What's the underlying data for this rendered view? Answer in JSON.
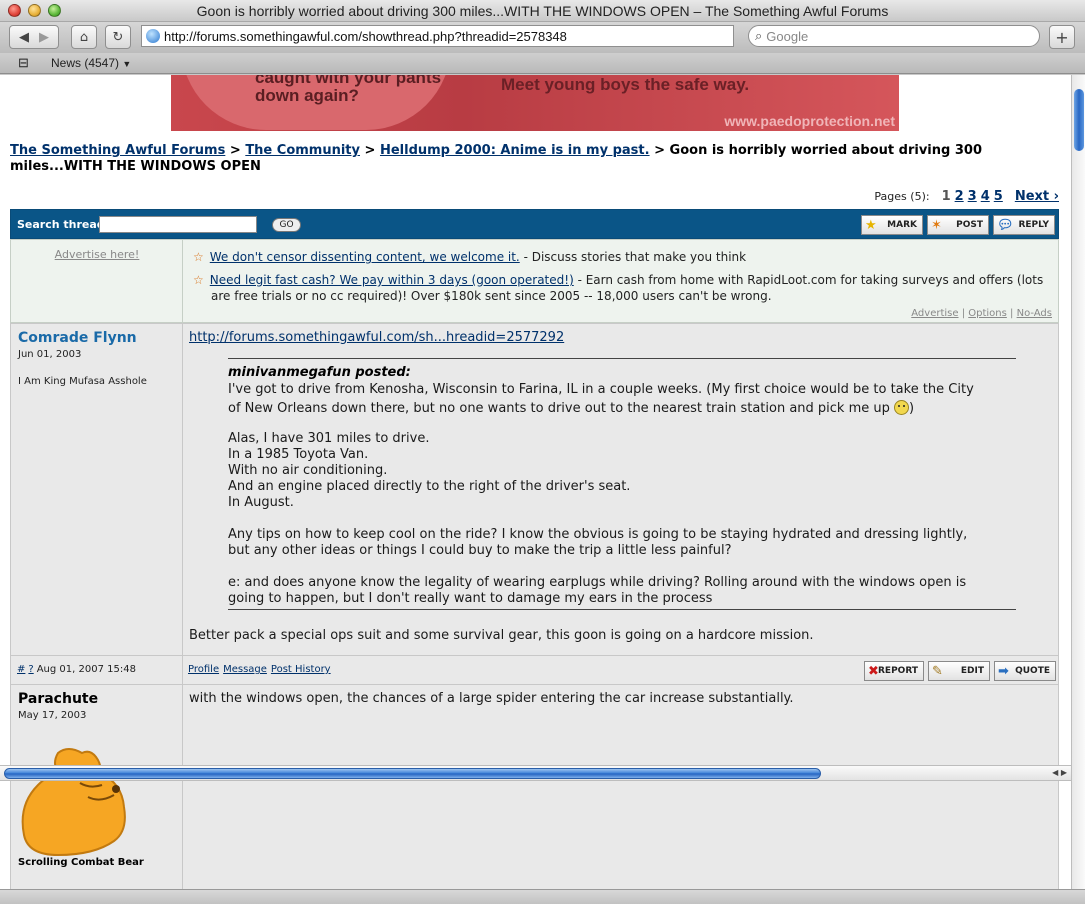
{
  "window": {
    "title": "Goon is horribly worried about driving 300 miles...WITH THE WINDOWS OPEN – The Something Awful Forums"
  },
  "toolbar": {
    "url": "http://forums.somethingawful.com/showthread.php?threadid=2578348",
    "search_placeholder": "Google",
    "add_tab": "+"
  },
  "bookmarks": {
    "news_label": "News (4547)"
  },
  "ad_banner": {
    "line1": "caught with your pants",
    "line2": "down again?",
    "tagline": "Meet young boys the safe way.",
    "url": "www.paedoprotection.net"
  },
  "breadcrumb": {
    "items": [
      "The Something Awful Forums",
      "The Community",
      "Helldump 2000: Anime is in my past."
    ],
    "separator": ">",
    "current": "Goon is horribly worried about driving 300 miles...WITH THE WINDOWS OPEN"
  },
  "pagination": {
    "label": "Pages (5):",
    "current": "1",
    "pages": [
      "2",
      "3",
      "4",
      "5"
    ],
    "next": "Next ›"
  },
  "thread_bar": {
    "search_label": "Search thread:",
    "go_label": "GO",
    "mark": "MARK",
    "post": "POST",
    "reply": "REPLY"
  },
  "ads_row": {
    "advertise_here": "Advertise here!",
    "ad1_link": "We don't censor dissenting content, we welcome it.",
    "ad1_text": " - Discuss stories that make you think",
    "ad2_link": "Need legit fast cash? We pay within 3 days (goon operated!)",
    "ad2_text": " - Earn cash from home with RapidLoot.com for taking surveys and offers (lots",
    "ad2_text2": "are free trials or no cc required)! Over $180k sent since 2005 -- 18,000 users can't be wrong.",
    "links": [
      "Advertise",
      "Options",
      "No-Ads"
    ]
  },
  "post1": {
    "username": "Comrade Flynn",
    "regdate": "Jun 01, 2003",
    "user_title": "I Am King Mufasa Asshole",
    "link": "http://forums.somethingawful.com/sh...hreadid=2577292",
    "quote_author": "minivanmegafun posted:",
    "quote_lines": [
      "I've got to drive from Kenosha, Wisconsin to Farina, IL in a couple weeks. (My first choice would be to take the City",
      "of New Orleans down there, but no one wants to drive out to the nearest train station and pick me up",
      "Alas, I have 301 miles to drive.",
      "In a 1985 Toyota Van.",
      "With no air conditioning.",
      "And an engine placed directly to the right of the driver's seat.",
      "In August.",
      "Any tips on how to keep cool on the ride? I know the obvious is going to be staying hydrated and dressing lightly,",
      "but any other ideas or things I could buy to make the trip a little less painful?",
      "e: and does anyone know the legality of wearing earplugs while driving? Rolling around with the windows open is",
      "going to happen, but I don't really want to damage my ears in the process"
    ],
    "quote_close": ")",
    "reply_text": "Better pack a special ops suit and some survival gear, this goon is going on a hardcore mission.",
    "footer_hash": "#",
    "footer_q": "?",
    "footer_date": "Aug 01, 2007 15:48",
    "profile": "Profile",
    "message": "Message",
    "history": "Post History",
    "report": "REPORT",
    "edit": "EDIT",
    "quote": "QUOTE"
  },
  "post2": {
    "username": "Parachute",
    "regdate": "May 17, 2003",
    "text": "with the windows open, the chances of a large spider entering the car increase substantially.",
    "avatar_caption": "Scrolling Combat Bear"
  },
  "colors": {
    "link": "#00316b",
    "thread_bar": "#0a5587",
    "post_bg": "#e9e9e9",
    "ad_row_bg": "#eef3ee"
  }
}
